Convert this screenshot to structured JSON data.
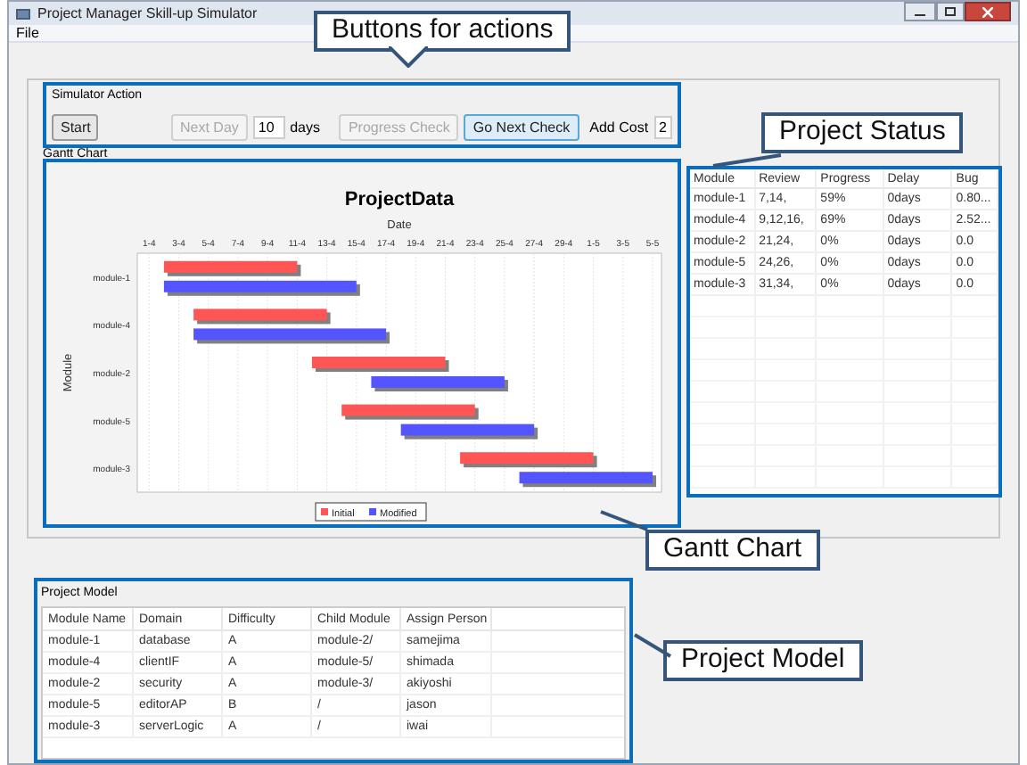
{
  "window": {
    "title": "Project Manager Skill-up Simulator"
  },
  "menu": [
    "File"
  ],
  "simulator_action": {
    "title": "Simulator Action",
    "start": {
      "label": "Start",
      "disabled": false
    },
    "next_day": {
      "label": "Next Day",
      "disabled": true
    },
    "days_value": "10",
    "days_label": "days",
    "progress_check": {
      "label": "Progress Check",
      "disabled": true
    },
    "go_next_check": {
      "label": "Go Next Check",
      "disabled": false
    },
    "add_cost_label": "Add Cost",
    "add_cost_value": "2"
  },
  "gantt": {
    "title": "Gantt Chart",
    "chart_title": "ProjectData",
    "xlabel": "Date",
    "ylabel": "Module",
    "modules": [
      "module-1",
      "module-4",
      "module-2",
      "module-5",
      "module-3"
    ],
    "dates": [
      "1-4",
      "3-4",
      "5-4",
      "7-4",
      "9-4",
      "11-4",
      "13-4",
      "15-4",
      "17-4",
      "19-4",
      "21-4",
      "23-4",
      "25-4",
      "27-4",
      "29-4",
      "1-5",
      "3-5",
      "5-5"
    ],
    "legend": [
      {
        "name": "Initial",
        "color": "#ff5555"
      },
      {
        "name": "Modified",
        "color": "#5555ff"
      }
    ]
  },
  "project_status": {
    "columns": [
      "Module",
      "Review",
      "Progress",
      "Delay",
      "Bug"
    ],
    "rows": [
      [
        "module-1",
        "7,14,",
        "59%",
        "0days",
        "0.80..."
      ],
      [
        "module-4",
        "9,12,16,",
        "69%",
        "0days",
        "2.52..."
      ],
      [
        "module-2",
        "21,24,",
        "0%",
        "0days",
        "0.0"
      ],
      [
        "module-5",
        "24,26,",
        "0%",
        "0days",
        "0.0"
      ],
      [
        "module-3",
        "31,34,",
        "0%",
        "0days",
        "0.0"
      ]
    ]
  },
  "project_model": {
    "title": "Project Model",
    "columns": [
      "Module Name",
      "Domain",
      "Difficulty",
      "Child Module",
      "Assign Person"
    ],
    "rows": [
      [
        "module-1",
        "database",
        "A",
        "module-2/",
        "samejima"
      ],
      [
        "module-4",
        "clientIF",
        "A",
        "module-5/",
        "shimada"
      ],
      [
        "module-2",
        "security",
        "A",
        "module-3/",
        "akiyoshi"
      ],
      [
        "module-5",
        "editorAP",
        "B",
        "/",
        "jason"
      ],
      [
        "module-3",
        "serverLogic",
        "A",
        "/",
        "iwai"
      ]
    ]
  },
  "callouts": [
    "Buttons for actions",
    "Project Status",
    "Gantt Chart",
    "Project Model"
  ]
}
